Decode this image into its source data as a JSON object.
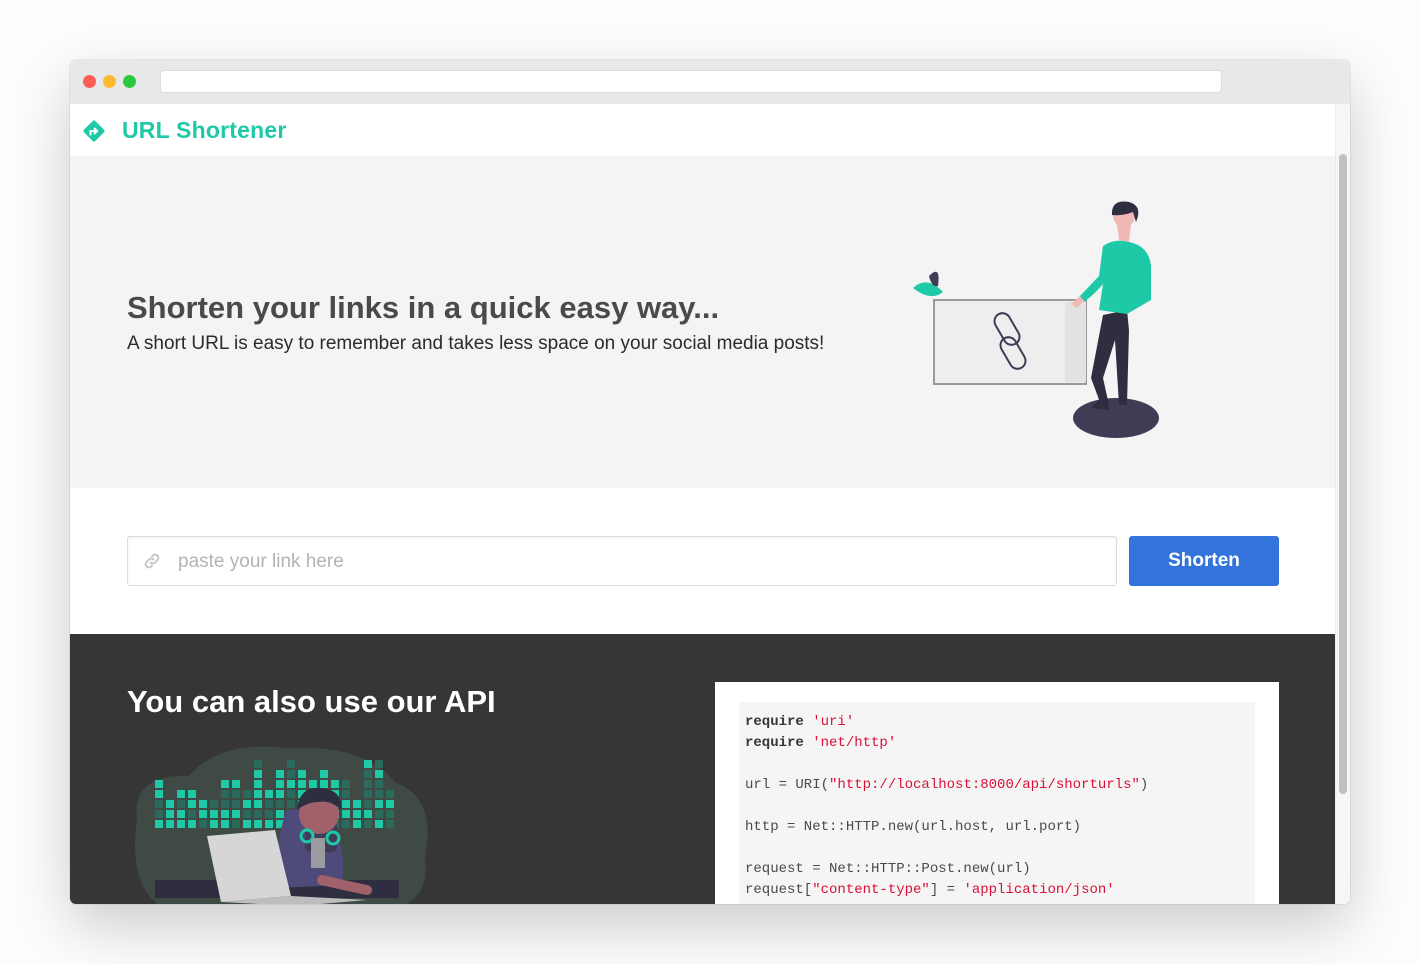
{
  "brand": {
    "name": "URL Shortener",
    "color": "#1ec9a7"
  },
  "hero": {
    "title": "Shorten your links in a quick easy way...",
    "subtitle": "A short URL is easy to remember and takes less space on your social media posts!"
  },
  "shorten_form": {
    "input_placeholder": "paste your link here",
    "input_value": "",
    "button_label": "Shorten",
    "button_color": "#3273dc"
  },
  "api": {
    "title": "You can also use our API",
    "code_lines": [
      [
        {
          "t": "require",
          "c": "kw"
        },
        {
          "t": " "
        },
        {
          "t": "'uri'",
          "c": "str"
        }
      ],
      [
        {
          "t": "require",
          "c": "kw"
        },
        {
          "t": " "
        },
        {
          "t": "'net/http'",
          "c": "str"
        }
      ],
      [],
      [
        {
          "t": "url = URI("
        },
        {
          "t": "\"http://localhost:8000/api/shorturls\"",
          "c": "str"
        },
        {
          "t": ")"
        }
      ],
      [],
      [
        {
          "t": "http = Net::HTTP.new(url.host, url.port)"
        }
      ],
      [],
      [
        {
          "t": "request = Net::HTTP::Post.new(url)"
        }
      ],
      [
        {
          "t": "request["
        },
        {
          "t": "\"content-type\"",
          "c": "str"
        },
        {
          "t": "] = "
        },
        {
          "t": "'application/json'",
          "c": "str"
        }
      ]
    ]
  },
  "icons": {
    "logo": "diamond-turn-right-icon",
    "input": "link-icon"
  },
  "colors": {
    "hero_bg": "#f4f4f4",
    "api_bg": "#363636",
    "code_string": "#da1039"
  }
}
